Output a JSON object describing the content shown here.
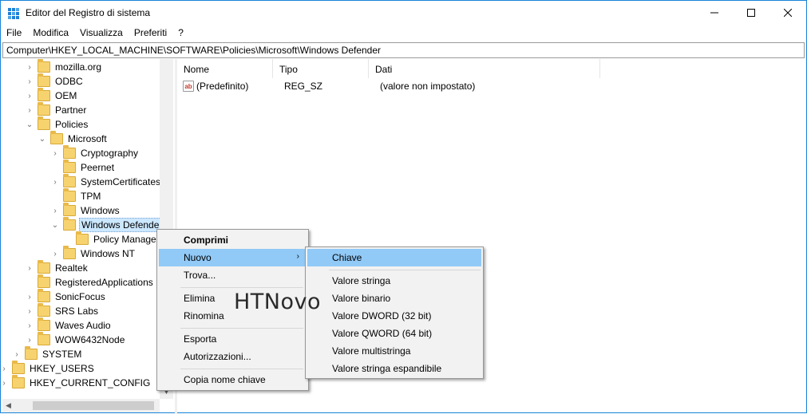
{
  "window": {
    "title": "Editor del Registro di sistema",
    "accent": "#1883d7"
  },
  "menubar": [
    "File",
    "Modifica",
    "Visualizza",
    "Preferiti",
    "?"
  ],
  "address": "Computer\\HKEY_LOCAL_MACHINE\\SOFTWARE\\Policies\\Microsoft\\Windows Defender",
  "tree": [
    {
      "label": "mozilla.org",
      "arrow": "›"
    },
    {
      "label": "ODBC",
      "arrow": "›"
    },
    {
      "label": "OEM",
      "arrow": "›"
    },
    {
      "label": "Partner",
      "arrow": "›"
    },
    {
      "label": "Policies",
      "arrow": "⌄"
    },
    {
      "label": "Microsoft",
      "arrow": "⌄"
    },
    {
      "label": "Cryptography",
      "arrow": "›"
    },
    {
      "label": "Peernet",
      "arrow": ""
    },
    {
      "label": "SystemCertificates",
      "arrow": "›"
    },
    {
      "label": "TPM",
      "arrow": ""
    },
    {
      "label": "Windows",
      "arrow": "›"
    },
    {
      "label": "Windows Defender",
      "arrow": "⌄"
    },
    {
      "label": "Policy Manager",
      "arrow": ""
    },
    {
      "label": "Windows NT",
      "arrow": "›"
    },
    {
      "label": "Realtek",
      "arrow": "›"
    },
    {
      "label": "RegisteredApplications",
      "arrow": ""
    },
    {
      "label": "SonicFocus",
      "arrow": "›"
    },
    {
      "label": "SRS Labs",
      "arrow": "›"
    },
    {
      "label": "Waves Audio",
      "arrow": "›"
    },
    {
      "label": "WOW6432Node",
      "arrow": "›"
    },
    {
      "label": "SYSTEM",
      "arrow": "›"
    },
    {
      "label": "HKEY_USERS",
      "arrow": "›"
    },
    {
      "label": "HKEY_CURRENT_CONFIG",
      "arrow": "›"
    }
  ],
  "list": {
    "columns": [
      "Nome",
      "Tipo",
      "Dati"
    ],
    "rows": [
      {
        "name": "(Predefinito)",
        "type": "REG_SZ",
        "data": "(valore non impostato)"
      }
    ]
  },
  "context_menu": {
    "items": [
      "Comprimi",
      "Nuovo",
      "Trova...",
      "Elimina",
      "Rinomina",
      "Esporta",
      "Autorizzazioni...",
      "Copia nome chiave"
    ],
    "highlight": "#91c9f7"
  },
  "submenu": {
    "items": [
      "Chiave",
      "Valore stringa",
      "Valore binario",
      "Valore DWORD (32 bit)",
      "Valore QWORD (64 bit)",
      "Valore multistringa",
      "Valore stringa espandibile"
    ]
  },
  "watermark": "HTNovo"
}
